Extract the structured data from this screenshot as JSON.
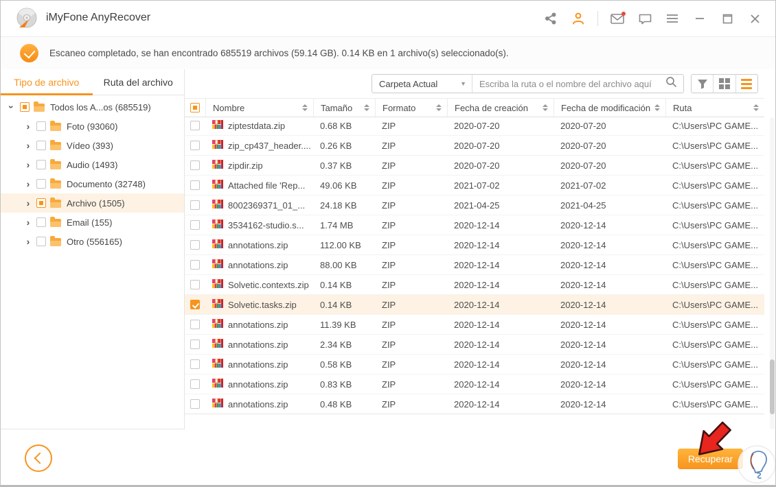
{
  "window": {
    "title": "iMyFone AnyRecover"
  },
  "titlebar": {
    "icons": [
      "share-icon",
      "account-icon",
      "mail-icon",
      "feedback-icon",
      "menu-icon",
      "minimize-icon",
      "maximize-icon",
      "close-icon"
    ],
    "accent_color": "#f7941d"
  },
  "banner": {
    "message": "Escaneo completado, se han encontrado 685519 archivos (59.14 GB). 0.14 KB en 1 archivo(s) seleccionado(s)."
  },
  "sidebar": {
    "tabs": [
      {
        "label": "Tipo de archivo",
        "active": true
      },
      {
        "label": "Ruta del archivo",
        "active": false
      }
    ],
    "tree": [
      {
        "label": "Todos los A...os (685519)",
        "level": 0,
        "expanded": true,
        "check": "partial",
        "highlight": false
      },
      {
        "label": "Foto (93060)",
        "level": 1,
        "expanded": false,
        "check": "empty",
        "highlight": false
      },
      {
        "label": "Vídeo (393)",
        "level": 1,
        "expanded": false,
        "check": "empty",
        "highlight": false
      },
      {
        "label": "Audio (1493)",
        "level": 1,
        "expanded": false,
        "check": "empty",
        "highlight": false
      },
      {
        "label": "Documento (32748)",
        "level": 1,
        "expanded": false,
        "check": "empty",
        "highlight": false
      },
      {
        "label": "Archivo (1505)",
        "level": 1,
        "expanded": false,
        "check": "partial",
        "highlight": true
      },
      {
        "label": "Email (155)",
        "level": 1,
        "expanded": false,
        "check": "empty",
        "highlight": false
      },
      {
        "label": "Otro (556165)",
        "level": 1,
        "expanded": false,
        "check": "empty",
        "highlight": false
      }
    ]
  },
  "toolbar": {
    "folder_dropdown_value": "Carpeta Actual",
    "search_placeholder": "Escriba la ruta o el nombre del archivo aquí",
    "view_active": "list"
  },
  "table": {
    "headers": [
      "Nombre",
      "Tamaño",
      "Formato",
      "Fecha de creación",
      "Fecha de modificación",
      "Ruta"
    ],
    "header_check": "partial",
    "rows": [
      {
        "name": "ziptestdata.zip",
        "size": "0.68 KB",
        "format": "ZIP",
        "created": "2020-07-20",
        "modified": "2020-07-20",
        "path": "C:\\Users\\PC GAME...",
        "checked": false
      },
      {
        "name": "zip_cp437_header....",
        "size": "0.26 KB",
        "format": "ZIP",
        "created": "2020-07-20",
        "modified": "2020-07-20",
        "path": "C:\\Users\\PC GAME...",
        "checked": false
      },
      {
        "name": "zipdir.zip",
        "size": "0.37 KB",
        "format": "ZIP",
        "created": "2020-07-20",
        "modified": "2020-07-20",
        "path": "C:\\Users\\PC GAME...",
        "checked": false
      },
      {
        "name": "Attached file 'Rep...",
        "size": "49.06 KB",
        "format": "ZIP",
        "created": "2021-07-02",
        "modified": "2021-07-02",
        "path": "C:\\Users\\PC GAME...",
        "checked": false
      },
      {
        "name": "8002369371_01_...",
        "size": "24.18 KB",
        "format": "ZIP",
        "created": "2021-04-25",
        "modified": "2021-04-25",
        "path": "C:\\Users\\PC GAME...",
        "checked": false
      },
      {
        "name": "3534162-studio.s...",
        "size": "1.74 MB",
        "format": "ZIP",
        "created": "2020-12-14",
        "modified": "2020-12-14",
        "path": "C:\\Users\\PC GAME...",
        "checked": false
      },
      {
        "name": "annotations.zip",
        "size": "112.00 KB",
        "format": "ZIP",
        "created": "2020-12-14",
        "modified": "2020-12-14",
        "path": "C:\\Users\\PC GAME...",
        "checked": false
      },
      {
        "name": "annotations.zip",
        "size": "88.00 KB",
        "format": "ZIP",
        "created": "2020-12-14",
        "modified": "2020-12-14",
        "path": "C:\\Users\\PC GAME...",
        "checked": false
      },
      {
        "name": "Solvetic.contexts.zip",
        "size": "0.14 KB",
        "format": "ZIP",
        "created": "2020-12-14",
        "modified": "2020-12-14",
        "path": "C:\\Users\\PC GAME...",
        "checked": false
      },
      {
        "name": "Solvetic.tasks.zip",
        "size": "0.14 KB",
        "format": "ZIP",
        "created": "2020-12-14",
        "modified": "2020-12-14",
        "path": "C:\\Users\\PC GAME...",
        "checked": true
      },
      {
        "name": "annotations.zip",
        "size": "11.39 KB",
        "format": "ZIP",
        "created": "2020-12-14",
        "modified": "2020-12-14",
        "path": "C:\\Users\\PC GAME...",
        "checked": false
      },
      {
        "name": "annotations.zip",
        "size": "2.34 KB",
        "format": "ZIP",
        "created": "2020-12-14",
        "modified": "2020-12-14",
        "path": "C:\\Users\\PC GAME...",
        "checked": false
      },
      {
        "name": "annotations.zip",
        "size": "0.58 KB",
        "format": "ZIP",
        "created": "2020-12-14",
        "modified": "2020-12-14",
        "path": "C:\\Users\\PC GAME...",
        "checked": false
      },
      {
        "name": "annotations.zip",
        "size": "0.83 KB",
        "format": "ZIP",
        "created": "2020-12-14",
        "modified": "2020-12-14",
        "path": "C:\\Users\\PC GAME...",
        "checked": false
      },
      {
        "name": "annotations.zip",
        "size": "0.48 KB",
        "format": "ZIP",
        "created": "2020-12-14",
        "modified": "2020-12-14",
        "path": "C:\\Users\\PC GAME...",
        "checked": false
      }
    ]
  },
  "footer": {
    "recover_label": "Recuperar"
  }
}
